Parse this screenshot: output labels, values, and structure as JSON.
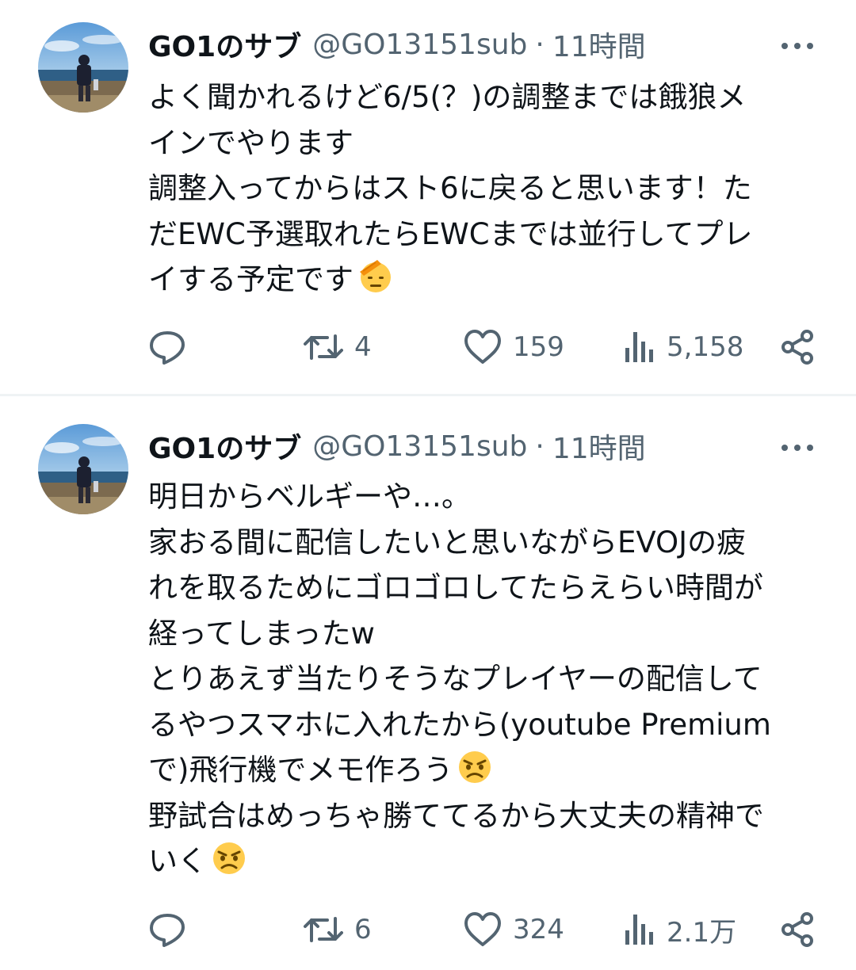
{
  "tweets": [
    {
      "author": {
        "display_name": "GO1のサブ",
        "handle": "@GO13151sub"
      },
      "separator": "·",
      "time": "11時間",
      "body_lines": [
        "よく聞かれるけど6/5(？)の調整までは餓狼メ",
        "インでやります",
        "調整入ってからはスト6に戻ると思います！た",
        "だEWC予選取れたらEWCまでは並行してプレ",
        "イする予定です"
      ],
      "emoji": "saluting-face",
      "stats": {
        "retweets": "4",
        "likes": "159",
        "views": "5,158"
      }
    },
    {
      "author": {
        "display_name": "GO1のサブ",
        "handle": "@GO13151sub"
      },
      "separator": "·",
      "time": "11時間",
      "body_lines": [
        "明日からベルギーや…。",
        "家おる間に配信したいと思いながらEVOJの疲",
        "れを取るためにゴロゴロしてたらえらい時間が",
        "経ってしまったw",
        "とりあえず当たりそうなプレイヤーの配信して",
        "るやつスマホに入れたから(youtube Premium",
        "で)飛行機でメモ作ろう",
        "野試合はめっちゃ勝ててるから大丈夫の精神で",
        "いく"
      ],
      "emoji": "angry-face",
      "stats": {
        "retweets": "6",
        "likes": "324",
        "views": "2.1万"
      }
    }
  ],
  "colors": {
    "text": "#0f1419",
    "secondary": "#536471",
    "divider": "#eff3f4",
    "emoji_yellow": "#ffcc4d"
  }
}
